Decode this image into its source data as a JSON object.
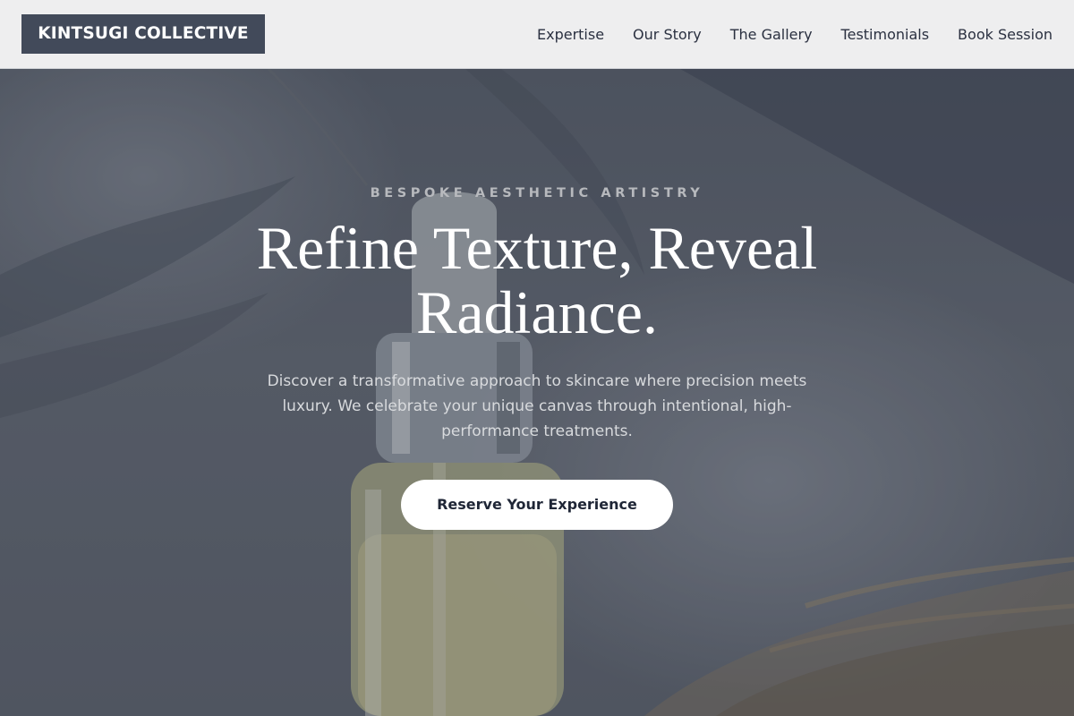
{
  "brand": {
    "name": "KINTSUGI COLLECTIVE"
  },
  "nav": {
    "items": [
      {
        "label": "Expertise"
      },
      {
        "label": "Our Story"
      },
      {
        "label": "The Gallery"
      },
      {
        "label": "Testimonials"
      },
      {
        "label": "Book Session"
      }
    ]
  },
  "hero": {
    "eyebrow": "BESPOKE AESTHETIC ARTISTRY",
    "headline": "Refine Texture, Reveal Radiance.",
    "subtext": "Discover a transformative approach to skincare where precision meets luxury. We celebrate your unique canvas through intentional, high-performance treatments.",
    "cta_label": "Reserve Your Experience",
    "image": {
      "subject": "serum-dropper-bottle",
      "icon": "photo"
    }
  },
  "colors": {
    "header_bg": "#eeeeef",
    "logo_bg": "#424a5a",
    "nav_text": "#2a3040",
    "hero_overlay": "#282e3c",
    "cta_bg": "#ffffff",
    "cta_text": "#1f2636"
  }
}
